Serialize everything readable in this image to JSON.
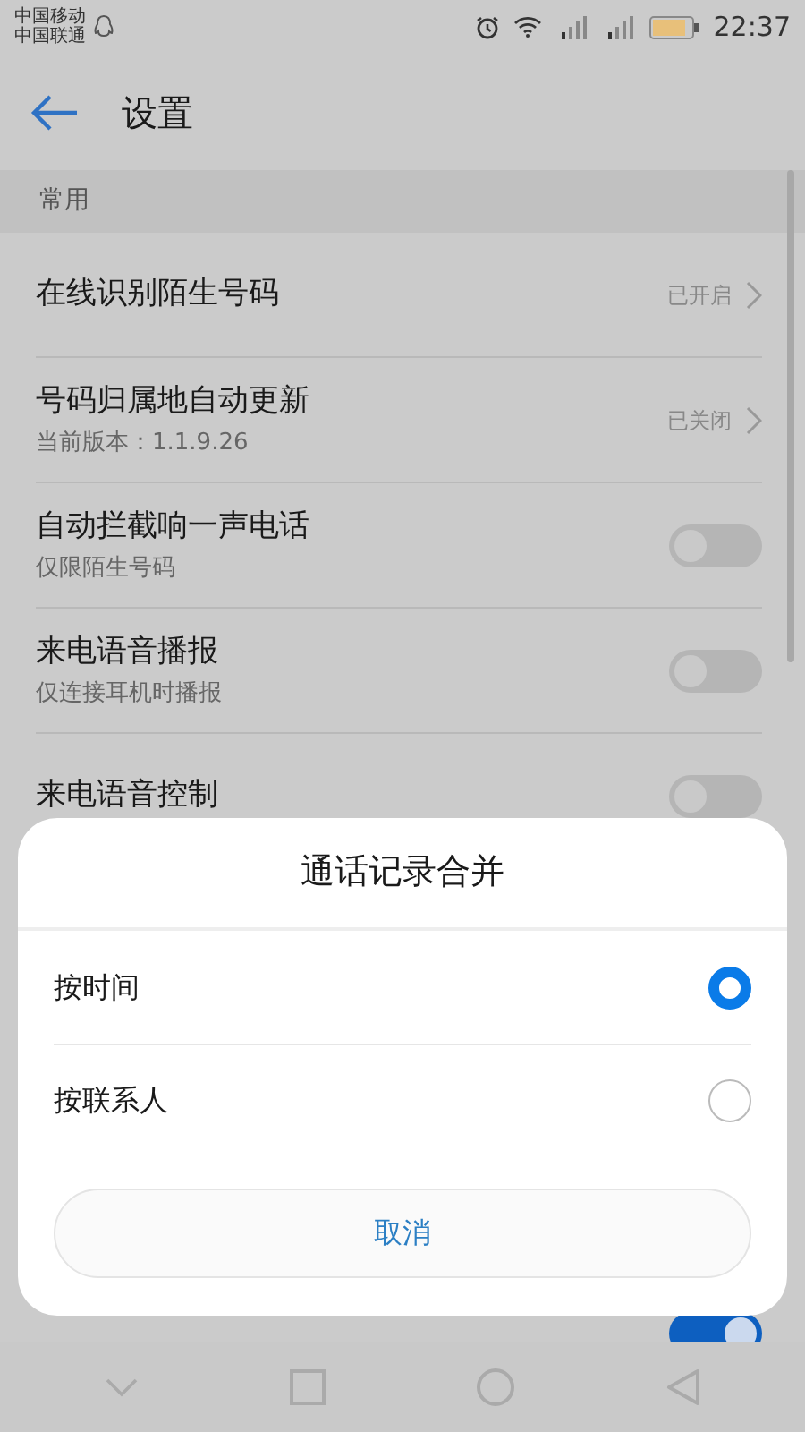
{
  "status_bar": {
    "carriers": [
      "中国移动",
      "中国联通"
    ],
    "time": "22:37"
  },
  "header": {
    "title": "设置"
  },
  "section": {
    "title": "常用"
  },
  "rows": [
    {
      "kind": "link",
      "title": "在线识别陌生号码",
      "value": "已开启"
    },
    {
      "kind": "link",
      "title": "号码归属地自动更新",
      "subtitle": "当前版本：1.1.9.26",
      "value": "已关闭"
    },
    {
      "kind": "switch",
      "title": "自动拦截响一声电话",
      "subtitle": "仅限陌生号码",
      "on": false
    },
    {
      "kind": "switch",
      "title": "来电语音播报",
      "subtitle": "仅连接耳机时播报",
      "on": false
    },
    {
      "kind": "switch",
      "title": "来电语音控制",
      "on": false
    }
  ],
  "bottom_row": {
    "on": true
  },
  "dialog": {
    "title": "通话记录合并",
    "options": [
      {
        "label": "按时间",
        "selected": true
      },
      {
        "label": "按联系人",
        "selected": false
      }
    ],
    "cancel": "取消"
  }
}
